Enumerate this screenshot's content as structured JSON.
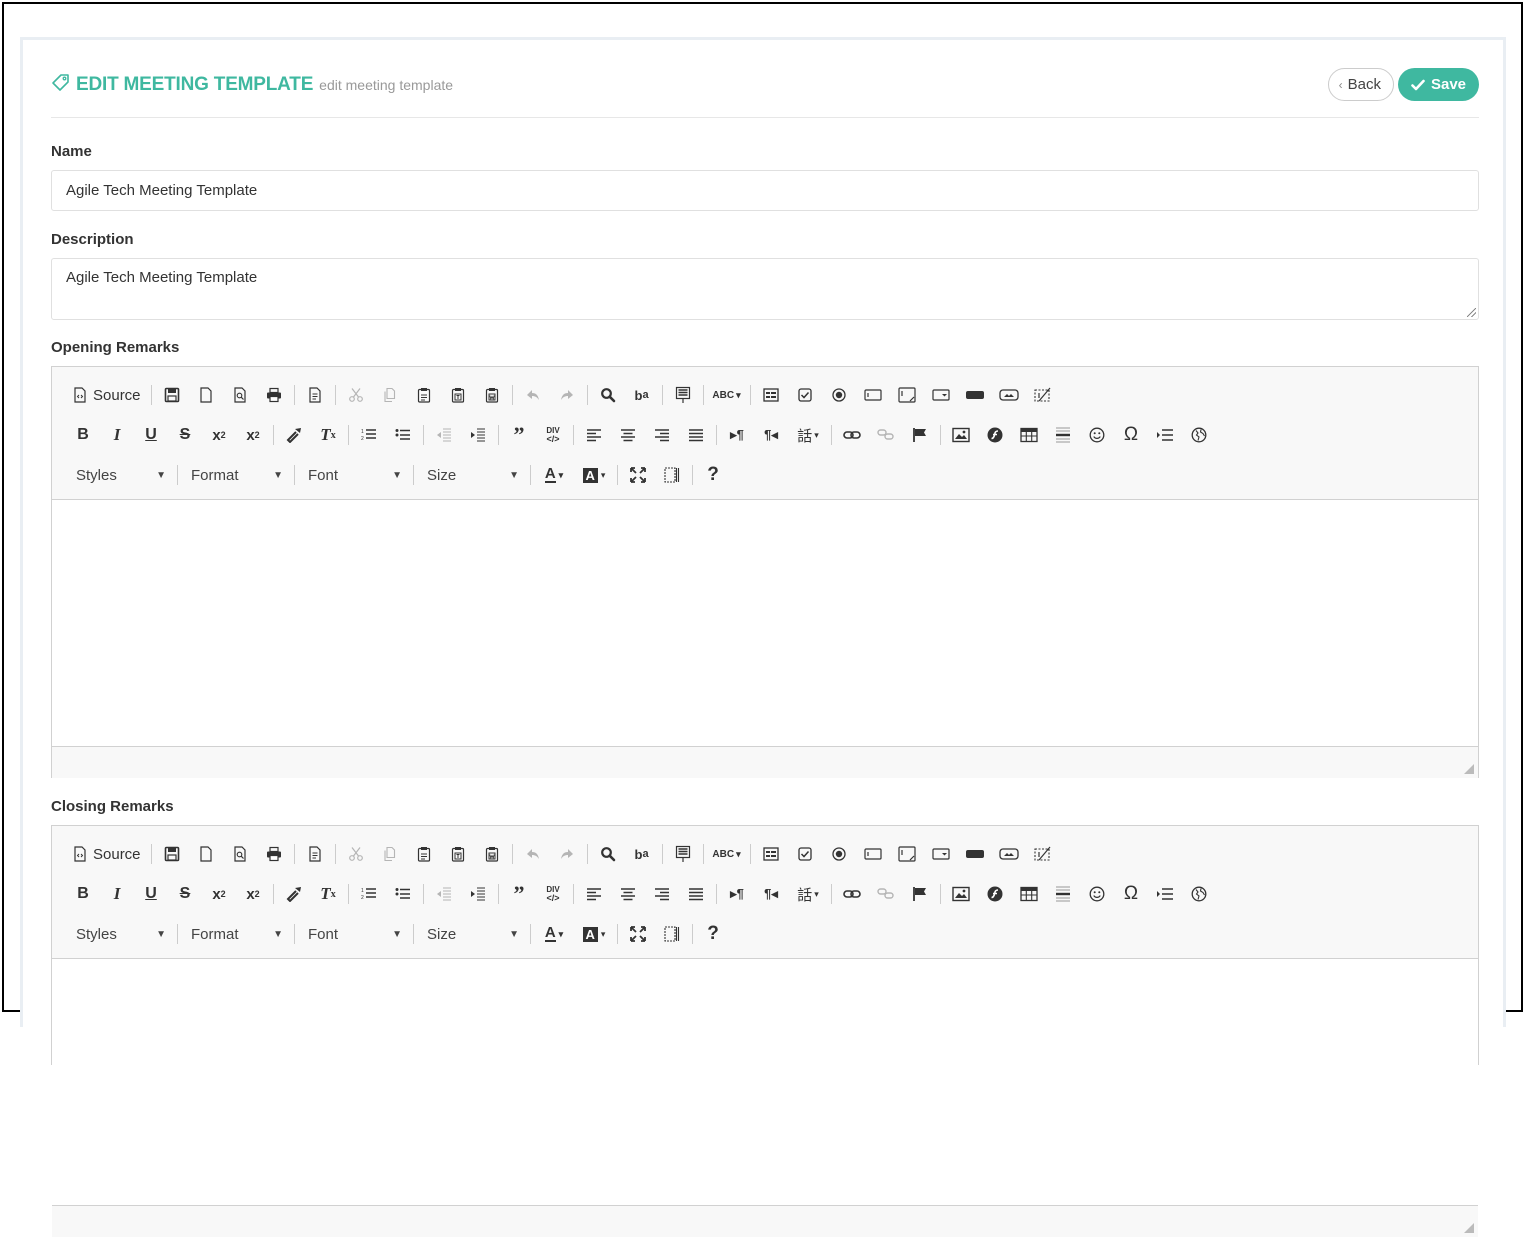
{
  "header": {
    "title": "EDIT MEETING TEMPLATE",
    "subtitle": "edit meeting template",
    "tag_icon": "tag-icon",
    "back_label": "Back",
    "save_label": "Save",
    "accent_color": "#3fb8a0"
  },
  "form": {
    "name_label": "Name",
    "name_value": "Agile Tech Meeting Template",
    "description_label": "Description",
    "description_value": "Agile Tech Meeting Template",
    "opening_label": "Opening Remarks",
    "closing_label": "Closing Remarks"
  },
  "toolbar": {
    "source_label": "Source",
    "combos": {
      "styles": "Styles",
      "format": "Format",
      "font": "Font",
      "size": "Size"
    },
    "row1_icons": [
      "source-icon",
      "save-icon",
      "new-page-icon",
      "preview-icon",
      "print-icon",
      "templates-icon",
      "cut-icon",
      "copy-icon",
      "paste-icon",
      "paste-text-icon",
      "paste-word-icon",
      "undo-icon",
      "redo-icon",
      "find-icon",
      "replace-icon",
      "select-all-icon",
      "spellcheck-icon",
      "form-icon",
      "checkbox-icon",
      "radio-icon",
      "textfield-icon",
      "textarea-icon",
      "select-icon",
      "button-icon",
      "imagebutton-icon",
      "hiddenfield-icon"
    ],
    "row2_icons": [
      "bold-icon",
      "italic-icon",
      "underline-icon",
      "strike-icon",
      "subscript-icon",
      "superscript-icon",
      "copy-format-icon",
      "remove-format-icon",
      "numbered-list-icon",
      "bulleted-list-icon",
      "outdent-icon",
      "indent-icon",
      "blockquote-icon",
      "div-icon",
      "align-left-icon",
      "align-center-icon",
      "align-right-icon",
      "justify-icon",
      "ltr-icon",
      "rtl-icon",
      "language-icon",
      "link-icon",
      "unlink-icon",
      "anchor-icon",
      "image-icon",
      "flash-icon",
      "table-icon",
      "horizontal-rule-icon",
      "smiley-icon",
      "special-char-icon",
      "page-break-icon",
      "iframe-icon"
    ],
    "row3_icons": [
      "text-color-icon",
      "bg-color-icon",
      "maximize-icon",
      "show-blocks-icon",
      "about-icon"
    ]
  }
}
